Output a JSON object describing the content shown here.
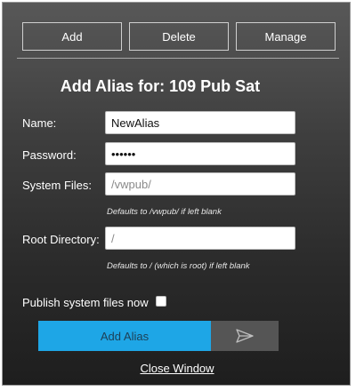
{
  "toolbar": {
    "add_label": "Add",
    "delete_label": "Delete",
    "manage_label": "Manage"
  },
  "form": {
    "title": "Add Alias for: 109 Pub Sat",
    "name": {
      "label": "Name:",
      "value": "NewAlias"
    },
    "password": {
      "label": "Password:",
      "value": "••••••"
    },
    "system_files": {
      "label": "System Files:",
      "placeholder": "/vwpub/",
      "hint": "Defaults to /vwpub/ if left blank"
    },
    "root_directory": {
      "label": "Root Directory:",
      "placeholder": "/",
      "hint": "Defaults to / (which is root) if left blank"
    },
    "publish": {
      "label": "Publish system files now",
      "checked": false
    },
    "submit_label": "Add Alias",
    "send_icon": "paper-plane-icon",
    "close_label": "Close Window"
  },
  "colors": {
    "accent": "#1ea6e6",
    "send_button": "#555555"
  }
}
